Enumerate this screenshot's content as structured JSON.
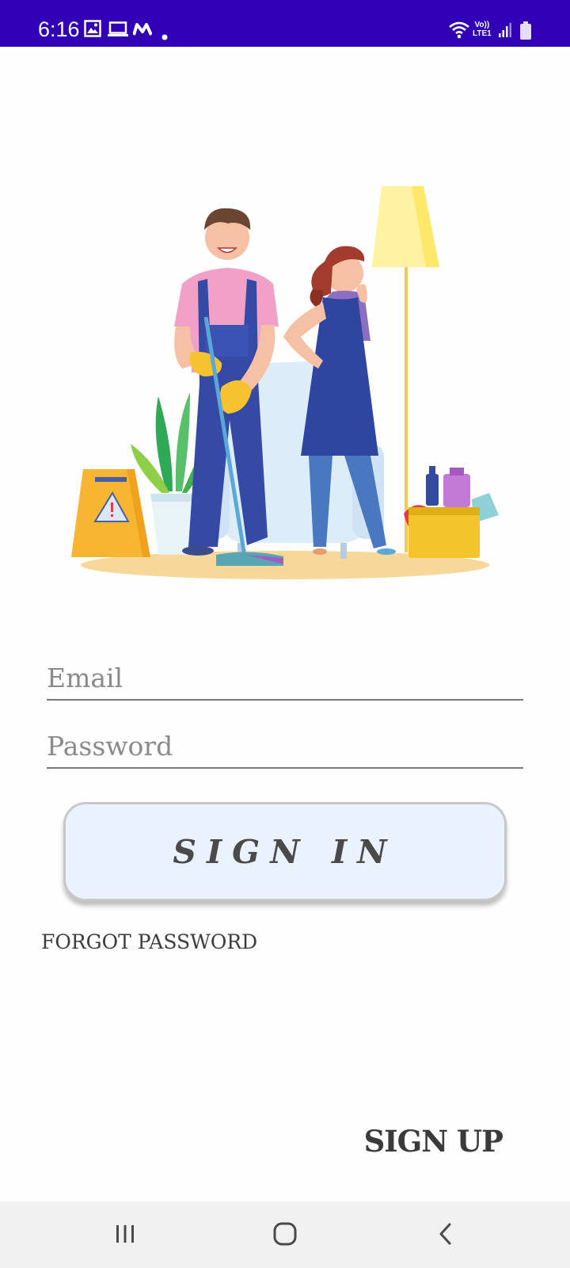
{
  "status_bar": {
    "time": "6:16",
    "left_icons": [
      "gallery-icon",
      "laptop-icon",
      "m-logo-icon",
      "dot-icon"
    ],
    "right_icons": [
      "wifi-icon",
      "volte-icon",
      "signal-icon",
      "battery-icon"
    ],
    "volte_text": "Vo))",
    "lte_text": "LTE1",
    "background": "#3200b4"
  },
  "form": {
    "email_placeholder": "Email",
    "email_value": "",
    "password_placeholder": "Password",
    "password_value": "",
    "signin_label": "SIGN IN",
    "forgot_label": "FORGOT PASSWORD",
    "signup_label": "SIGN UP"
  },
  "illustration": {
    "icon": "cleaning-staff-illustration"
  },
  "nav_bar": {
    "icons": [
      "recent-apps-icon",
      "home-icon",
      "back-icon"
    ]
  },
  "colors": {
    "button_bg": "#eaf2fd",
    "accent": "#3200b4"
  }
}
